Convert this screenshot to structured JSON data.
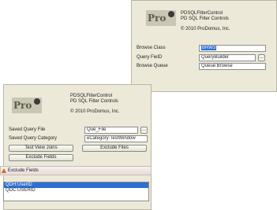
{
  "top_panel": {
    "logo_text": "ProDomus",
    "product_name": "PDSQLFilterControl",
    "product_desc": "PD SQL Filter Controls",
    "copyright": "© 2010 ProDomus, Inc.",
    "fields": [
      {
        "label": "Browse Class",
        "value": "BRW3",
        "selected": true
      },
      {
        "label": "Query FieID",
        "value": "QueryBuilder"
      },
      {
        "label": "Browse Queue",
        "value": "Queue:Browse"
      }
    ],
    "ellipsis_label": "..."
  },
  "bottom_panel": {
    "logo_text": "ProDomus",
    "product_name": "PDSQLFilterControl",
    "product_desc": "PD SQL Filter Controls",
    "copyright": "© 2010 ProDomus, Inc.",
    "saved_query_file_label": "Saved Query File",
    "saved_query_file_value": "Que_File",
    "saved_query_category_label": "Saved Query Category",
    "saved_query_category_value": "eCategory:TestWindow",
    "test_view_joins_label": "Test View Joins",
    "exclude_files_label": "Exclude Files",
    "exclude_fields_label": "Exclude Fields",
    "ellipsis_label": "..."
  },
  "exclude_fields_window": {
    "title": "Exclude Fields",
    "items": [
      "QDH:UserID",
      "QDC:USERID"
    ],
    "selected_index": 0
  }
}
